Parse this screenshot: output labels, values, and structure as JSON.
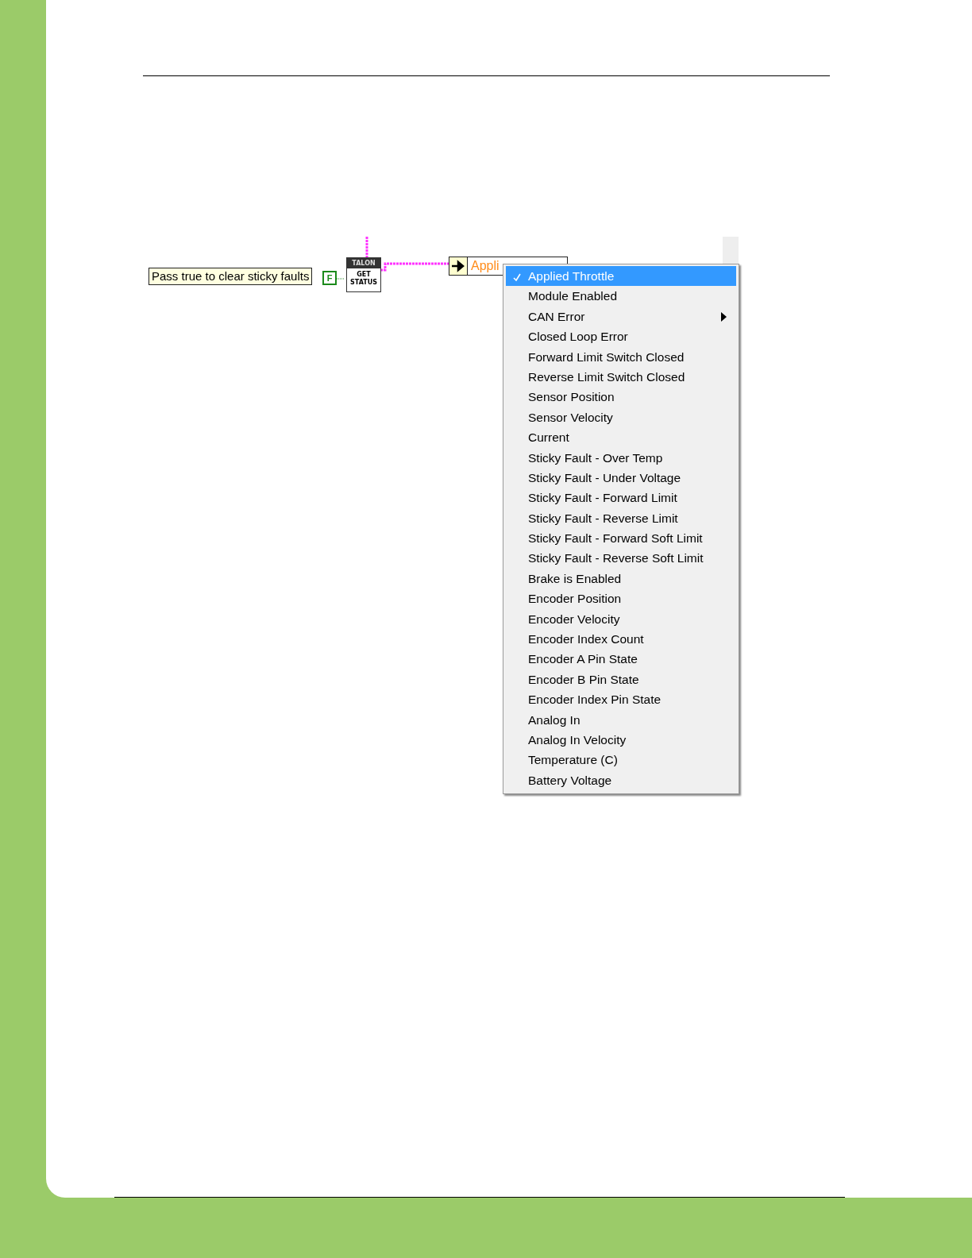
{
  "diagram": {
    "comment": "Pass true to clear sticky faults",
    "constant": "F",
    "node": {
      "header": "TALON",
      "label": "GET STATUS"
    },
    "unbundle": {
      "field": "Appli"
    }
  },
  "menu": {
    "items": [
      {
        "label": "Applied Throttle",
        "selected": true,
        "submenu": false
      },
      {
        "label": "Module Enabled",
        "selected": false,
        "submenu": false
      },
      {
        "label": "CAN Error",
        "selected": false,
        "submenu": true
      },
      {
        "label": "Closed Loop Error",
        "selected": false,
        "submenu": false
      },
      {
        "label": "Forward Limit Switch Closed",
        "selected": false,
        "submenu": false
      },
      {
        "label": "Reverse Limit Switch Closed",
        "selected": false,
        "submenu": false
      },
      {
        "label": "Sensor Position",
        "selected": false,
        "submenu": false
      },
      {
        "label": "Sensor Velocity",
        "selected": false,
        "submenu": false
      },
      {
        "label": "Current",
        "selected": false,
        "submenu": false
      },
      {
        "label": "Sticky Fault - Over Temp",
        "selected": false,
        "submenu": false
      },
      {
        "label": "Sticky Fault - Under Voltage",
        "selected": false,
        "submenu": false
      },
      {
        "label": "Sticky Fault - Forward Limit",
        "selected": false,
        "submenu": false
      },
      {
        "label": "Sticky Fault - Reverse Limit",
        "selected": false,
        "submenu": false
      },
      {
        "label": "Sticky Fault - Forward Soft Limit",
        "selected": false,
        "submenu": false
      },
      {
        "label": "Sticky Fault - Reverse Soft Limit",
        "selected": false,
        "submenu": false
      },
      {
        "label": "Brake is Enabled",
        "selected": false,
        "submenu": false
      },
      {
        "label": "Encoder Position",
        "selected": false,
        "submenu": false
      },
      {
        "label": "Encoder Velocity",
        "selected": false,
        "submenu": false
      },
      {
        "label": "Encoder Index Count",
        "selected": false,
        "submenu": false
      },
      {
        "label": "Encoder A Pin State",
        "selected": false,
        "submenu": false
      },
      {
        "label": "Encoder B Pin State",
        "selected": false,
        "submenu": false
      },
      {
        "label": "Encoder Index Pin State",
        "selected": false,
        "submenu": false
      },
      {
        "label": "Analog In",
        "selected": false,
        "submenu": false
      },
      {
        "label": "Analog In Velocity",
        "selected": false,
        "submenu": false
      },
      {
        "label": "Temperature (C)",
        "selected": false,
        "submenu": false
      },
      {
        "label": "Battery Voltage",
        "selected": false,
        "submenu": false
      }
    ]
  }
}
